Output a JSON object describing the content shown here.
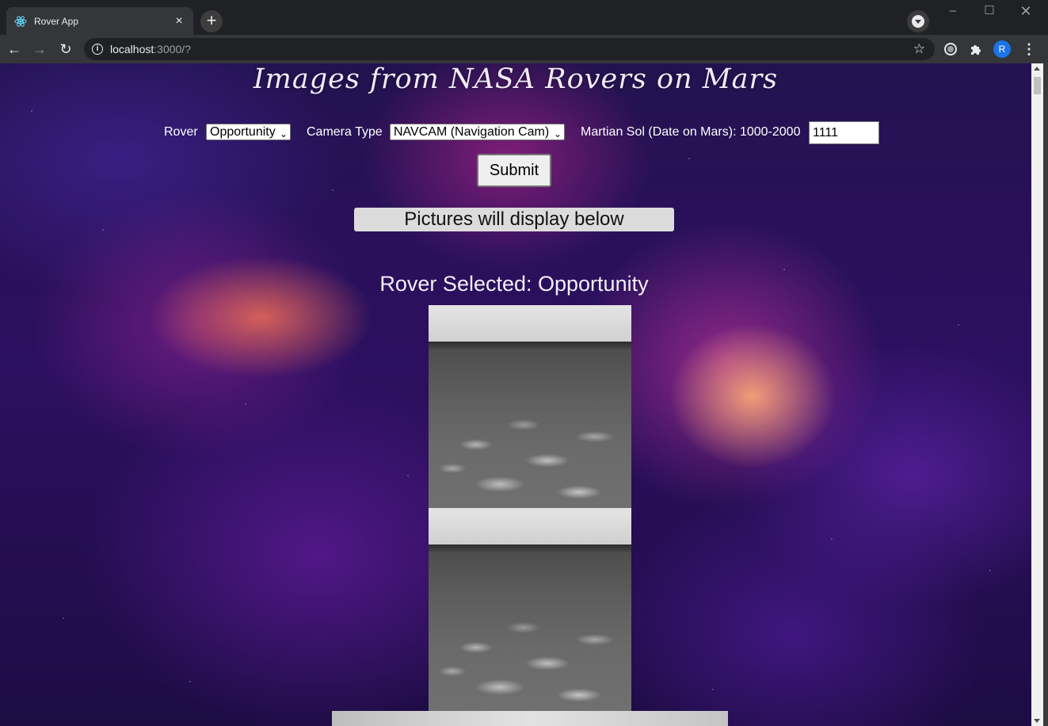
{
  "browser": {
    "tab_title": "Rover App",
    "url_host": "localhost",
    "url_path": ":3000/?",
    "profile_initial": "R",
    "icons": [
      "react-favicon-icon",
      "close-icon",
      "plus-icon",
      "tab-search-icon",
      "minimize-icon",
      "maximize-icon",
      "close-window-icon",
      "back-arrow-icon",
      "forward-arrow-icon",
      "reload-icon",
      "info-icon",
      "star-icon",
      "extension-circle-icon",
      "puzzle-icon",
      "kebab-menu-icon"
    ]
  },
  "page": {
    "title": "Images from NASA Rovers on Mars",
    "form": {
      "rover_label": "Rover",
      "rover_value": "Opportunity",
      "camera_label": "Camera Type",
      "camera_value": "NAVCAM (Navigation Cam)",
      "sol_label": "Martian Sol (Date on Mars): 1000-2000",
      "sol_value": "1111",
      "submit_label": "Submit"
    },
    "notice": "Pictures will display below",
    "rover_selected": "Rover Selected: Opportunity"
  },
  "colors": {
    "chrome_dark": "#202124",
    "toolbar": "#35363a",
    "profile_blue": "#1a73e8",
    "notice_bg": "#dcdcdc"
  }
}
